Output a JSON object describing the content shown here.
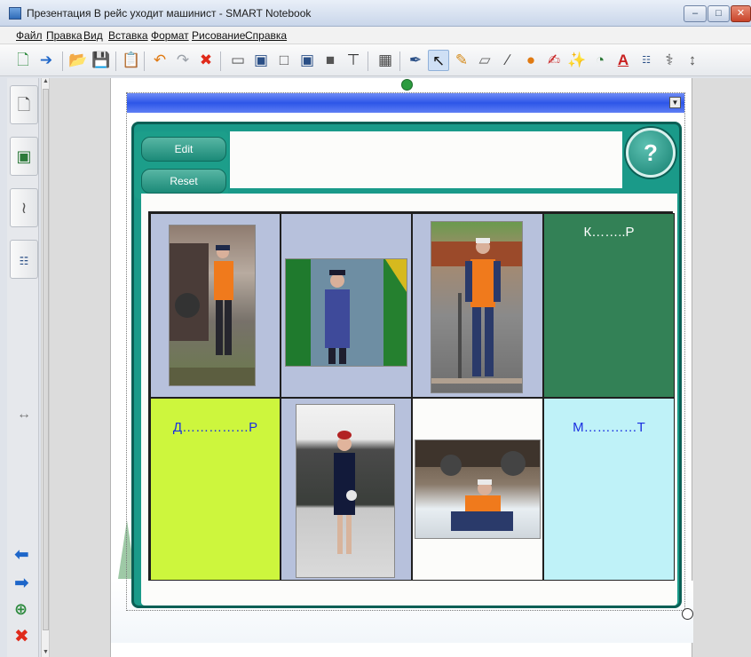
{
  "window": {
    "title": "Презентация В рейс уходит машинист - SMART Notebook",
    "minimize": "–",
    "maximize": "□",
    "close": "✕"
  },
  "menu": [
    "Файл",
    "Правка",
    "Вид",
    "Вставка",
    "Формат",
    "Рисование",
    "Справка"
  ],
  "toolbar_icons": [
    "new-page",
    "next-page",
    "open",
    "save",
    "paste",
    "undo",
    "redo",
    "delete",
    "screen-shade",
    "show-all",
    "dual-display",
    "full-screen",
    "capture",
    "document-camera",
    "table",
    "pen",
    "select",
    "creative-pen",
    "eraser",
    "line",
    "shape-fill",
    "magic-pen",
    "highlighter",
    "fill",
    "text",
    "properties",
    "recognize",
    "more"
  ],
  "colors": {
    "board_teal": "#1a9a89",
    "header_blue": "#2d56e8",
    "cell_green_dark": "#338156",
    "cell_lime": "#cdf63d",
    "cell_cyan": "#bff2f8",
    "cell_lilac": "#b7c1dc",
    "word_blue": "#1a2fe0"
  },
  "widget": {
    "edit_label": "Edit",
    "reset_label": "Reset",
    "help_label": "?"
  },
  "cells": [
    {
      "id": "photo-1",
      "kind": "photo",
      "bg": "#b7c1dc"
    },
    {
      "id": "photo-2",
      "kind": "photo",
      "bg": "#b7c1dc"
    },
    {
      "id": "photo-3",
      "kind": "photo",
      "bg": "#b7c1dc"
    },
    {
      "id": "word-1",
      "kind": "word",
      "bg": "#338156",
      "text": "К……..Р",
      "color": "#ffffff"
    },
    {
      "id": "word-2",
      "kind": "word",
      "bg": "#cdf63d",
      "text": "Д……………Р",
      "color": "#1a2fe0"
    },
    {
      "id": "photo-4",
      "kind": "photo",
      "bg": "#b7c1dc"
    },
    {
      "id": "photo-5",
      "kind": "photo",
      "bg": "#fcfcfa"
    },
    {
      "id": "word-3",
      "kind": "word",
      "bg": "#bff2f8",
      "text": "М…………Т",
      "color": "#1a2fe0"
    }
  ]
}
